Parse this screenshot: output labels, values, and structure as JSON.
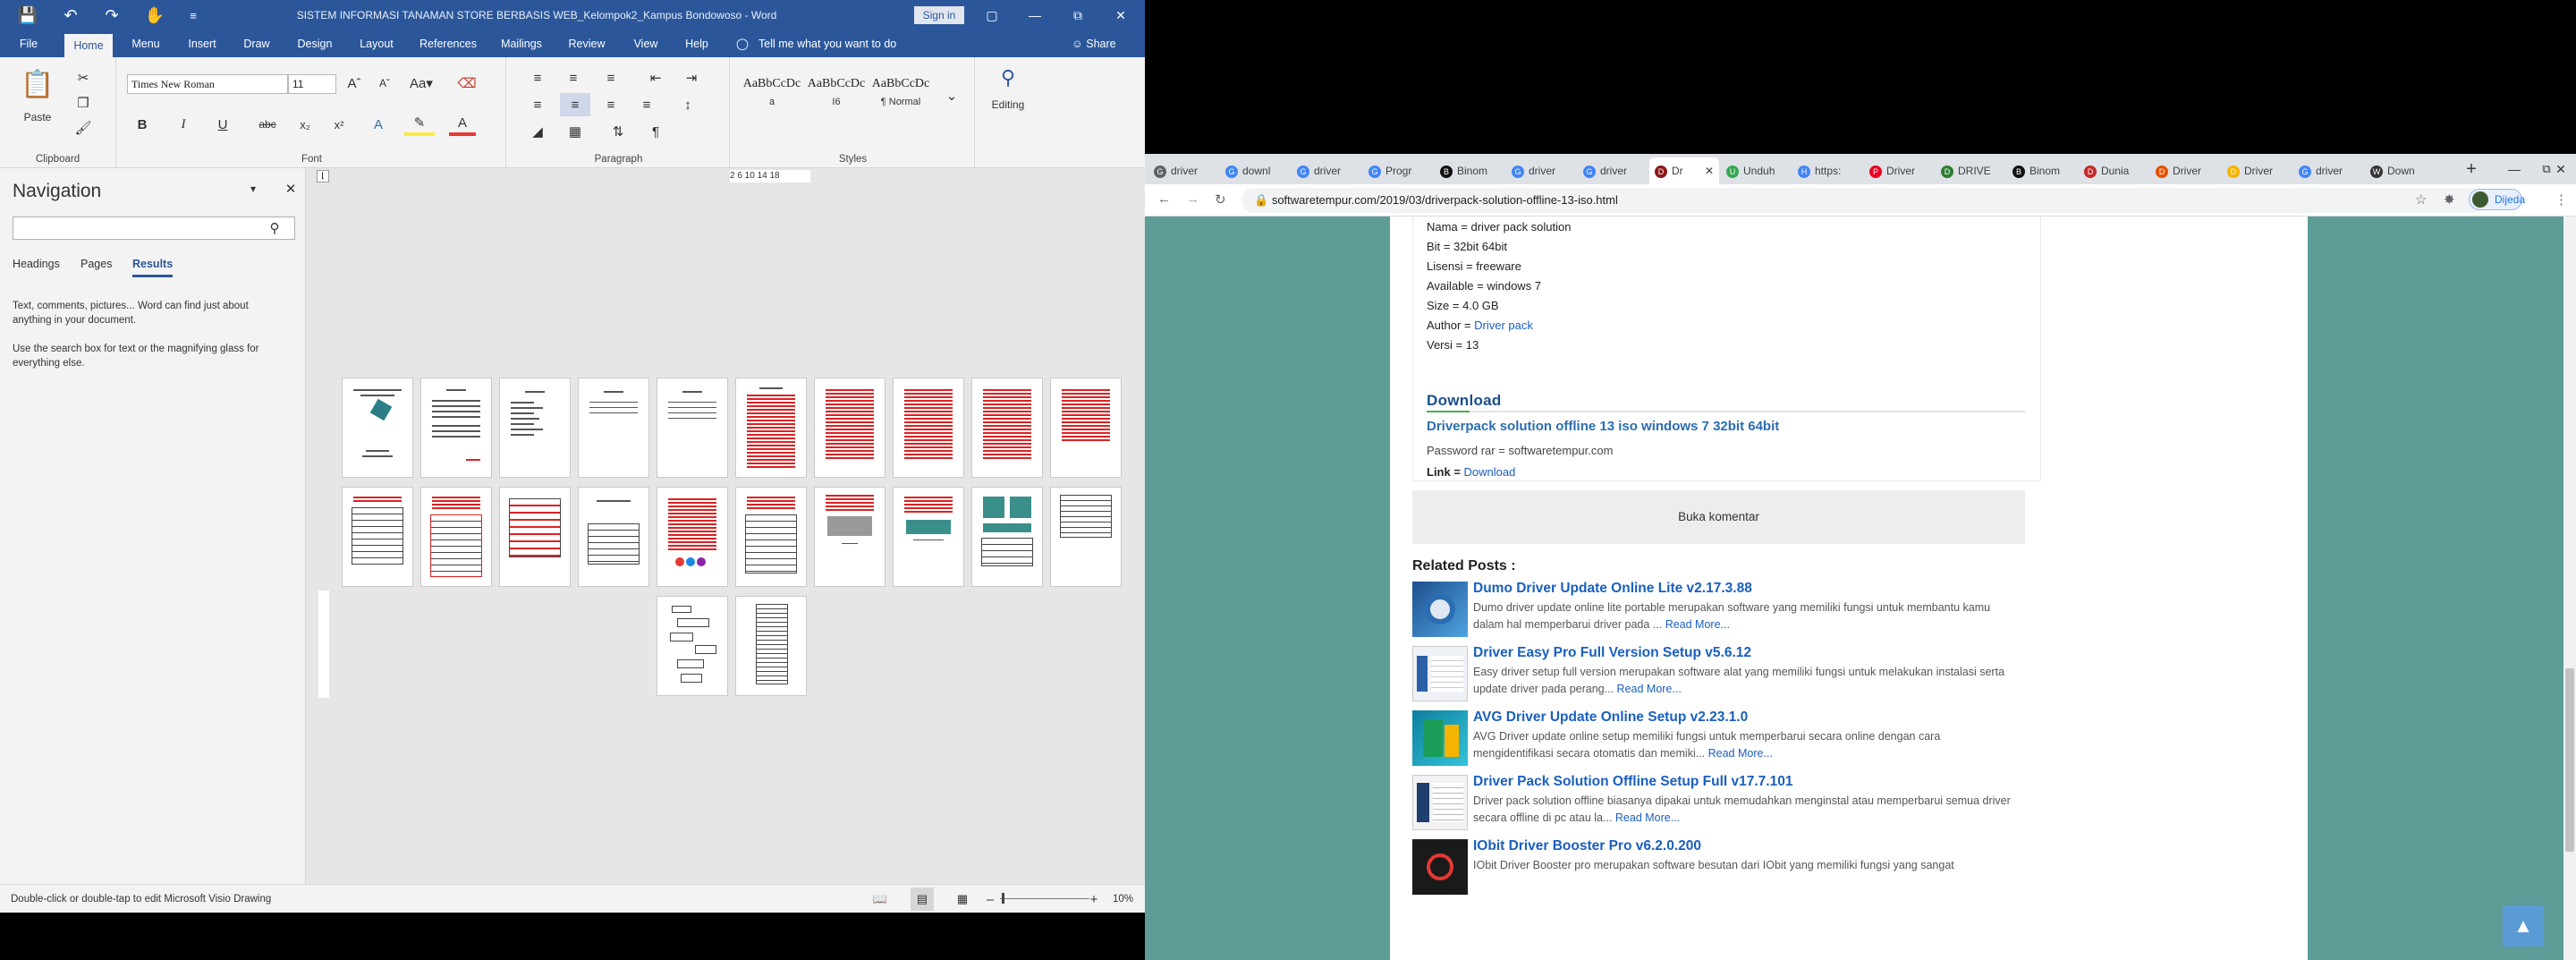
{
  "word": {
    "title": "SISTEM INFORMASI TANAMAN STORE BERBASIS WEB_Kelompok2_Kampus Bondowoso  -  Word",
    "sign_in": "Sign in",
    "tabs": [
      "File",
      "Home",
      "Menu",
      "Insert",
      "Draw",
      "Design",
      "Layout",
      "References",
      "Mailings",
      "Review",
      "View",
      "Help"
    ],
    "tell_me": "Tell me what you want to do",
    "share": "Share",
    "ribbon": {
      "paste": "Paste",
      "clipboard": "Clipboard",
      "font_name": "Times New Roman",
      "font_size": "11",
      "font": "Font",
      "paragraph": "Paragraph",
      "styles": "Styles",
      "style_items": [
        {
          "preview": "AaBbCcDc",
          "name": "a"
        },
        {
          "preview": "AaBbCcDc",
          "name": "I6"
        },
        {
          "preview": "AaBbCcDc",
          "name": "¶ Normal"
        }
      ],
      "editing": "Editing"
    },
    "nav": {
      "title": "Navigation",
      "tabs": [
        "Headings",
        "Pages",
        "Results"
      ],
      "text1": "Text, comments, pictures... Word can find just about anything in your document.",
      "text2": "Use the search box for text or the magnifying glass for everything else."
    },
    "ruler": "2  6  10  14  18",
    "status": "Double-click or double-tap to edit Microsoft Visio Drawing",
    "zoom": "10%"
  },
  "chrome": {
    "tabs": [
      {
        "label": "driver",
        "icon": "G",
        "color": "#5f6368"
      },
      {
        "label": "downl",
        "icon": "G",
        "color": "#4285f4"
      },
      {
        "label": "driver",
        "icon": "G",
        "color": "#4285f4"
      },
      {
        "label": "Progr",
        "icon": "G",
        "color": "#4285f4"
      },
      {
        "label": "Binom",
        "icon": "B",
        "color": "#111"
      },
      {
        "label": "driver",
        "icon": "G",
        "color": "#4285f4"
      },
      {
        "label": "driver",
        "icon": "G",
        "color": "#4285f4"
      },
      {
        "label": "Dr",
        "icon": "D",
        "color": "#8b1a1a"
      },
      {
        "label": "Unduh",
        "icon": "U",
        "color": "#34a853"
      },
      {
        "label": "https:",
        "icon": "H",
        "color": "#4285f4"
      },
      {
        "label": "Driver",
        "icon": "P",
        "color": "#e60023"
      },
      {
        "label": "DRIVE",
        "icon": "D",
        "color": "#2e7d32"
      },
      {
        "label": "Binom",
        "icon": "B",
        "color": "#111"
      },
      {
        "label": "Dunia",
        "icon": "D",
        "color": "#c62828"
      },
      {
        "label": "Driver",
        "icon": "D",
        "color": "#e65100"
      },
      {
        "label": "Driver",
        "icon": "D",
        "color": "#f4b400"
      },
      {
        "label": "driver",
        "icon": "G",
        "color": "#4285f4"
      },
      {
        "label": "Down",
        "icon": "W",
        "color": "#333"
      }
    ],
    "url": "softwaretempur.com/2019/03/driverpack-solution-offline-13-iso.html",
    "profile": "Dijeda"
  },
  "page": {
    "info": [
      {
        "label": "Nama = driver pack solution"
      },
      {
        "label": "Bit = 32bit 64bit"
      },
      {
        "label": "Lisensi = freeware"
      },
      {
        "label": "Available = windows 7"
      },
      {
        "label": "Size = 4.0 GB"
      },
      {
        "label": "Author = ",
        "link": "Driver pack"
      },
      {
        "label": "Versi = 13"
      }
    ],
    "download_heading": "Download",
    "download_link": "Driverpack solution offline 13 iso windows 7 32bit 64bit",
    "password": "Password rar = softwaretempur.com",
    "link_label": "Link = ",
    "link_text": "Download",
    "buka": "Buka komentar",
    "related_title": "Related Posts :",
    "posts": [
      {
        "title": "Dumo Driver Update Online Lite v2.17.3.88",
        "desc": "Dumo driver update online lite portable merupakan software yang memiliki fungsi untuk membantu kamu dalam hal memperbarui driver pada ...",
        "more": "Read More..."
      },
      {
        "title": "Driver Easy Pro Full Version Setup v5.6.12",
        "desc": "Easy driver setup full version merupakan software alat yang memiliki fungsi untuk melakukan instalasi serta update driver pada perang...",
        "more": "Read More..."
      },
      {
        "title": "AVG Driver Update Online Setup v2.23.1.0",
        "desc": "AVG Driver update online setup memiliki fungsi untuk memperbarui secara online dengan cara mengidentifikasi secara otomatis dan memiki...",
        "more": "Read More..."
      },
      {
        "title": "Driver Pack Solution Offline Setup Full v17.7.101",
        "desc": "Driver pack solution offline biasanya dipakai untuk memudahkan menginstal atau memperbarui semua driver secara offline di pc atau la...",
        "more": "Read More..."
      },
      {
        "title": "IObit Driver Booster Pro v6.2.0.200",
        "desc": "IObit Driver Booster pro merupakan software besutan dari IObit yang memiliki fungsi yang sangat",
        "more": ""
      }
    ]
  }
}
